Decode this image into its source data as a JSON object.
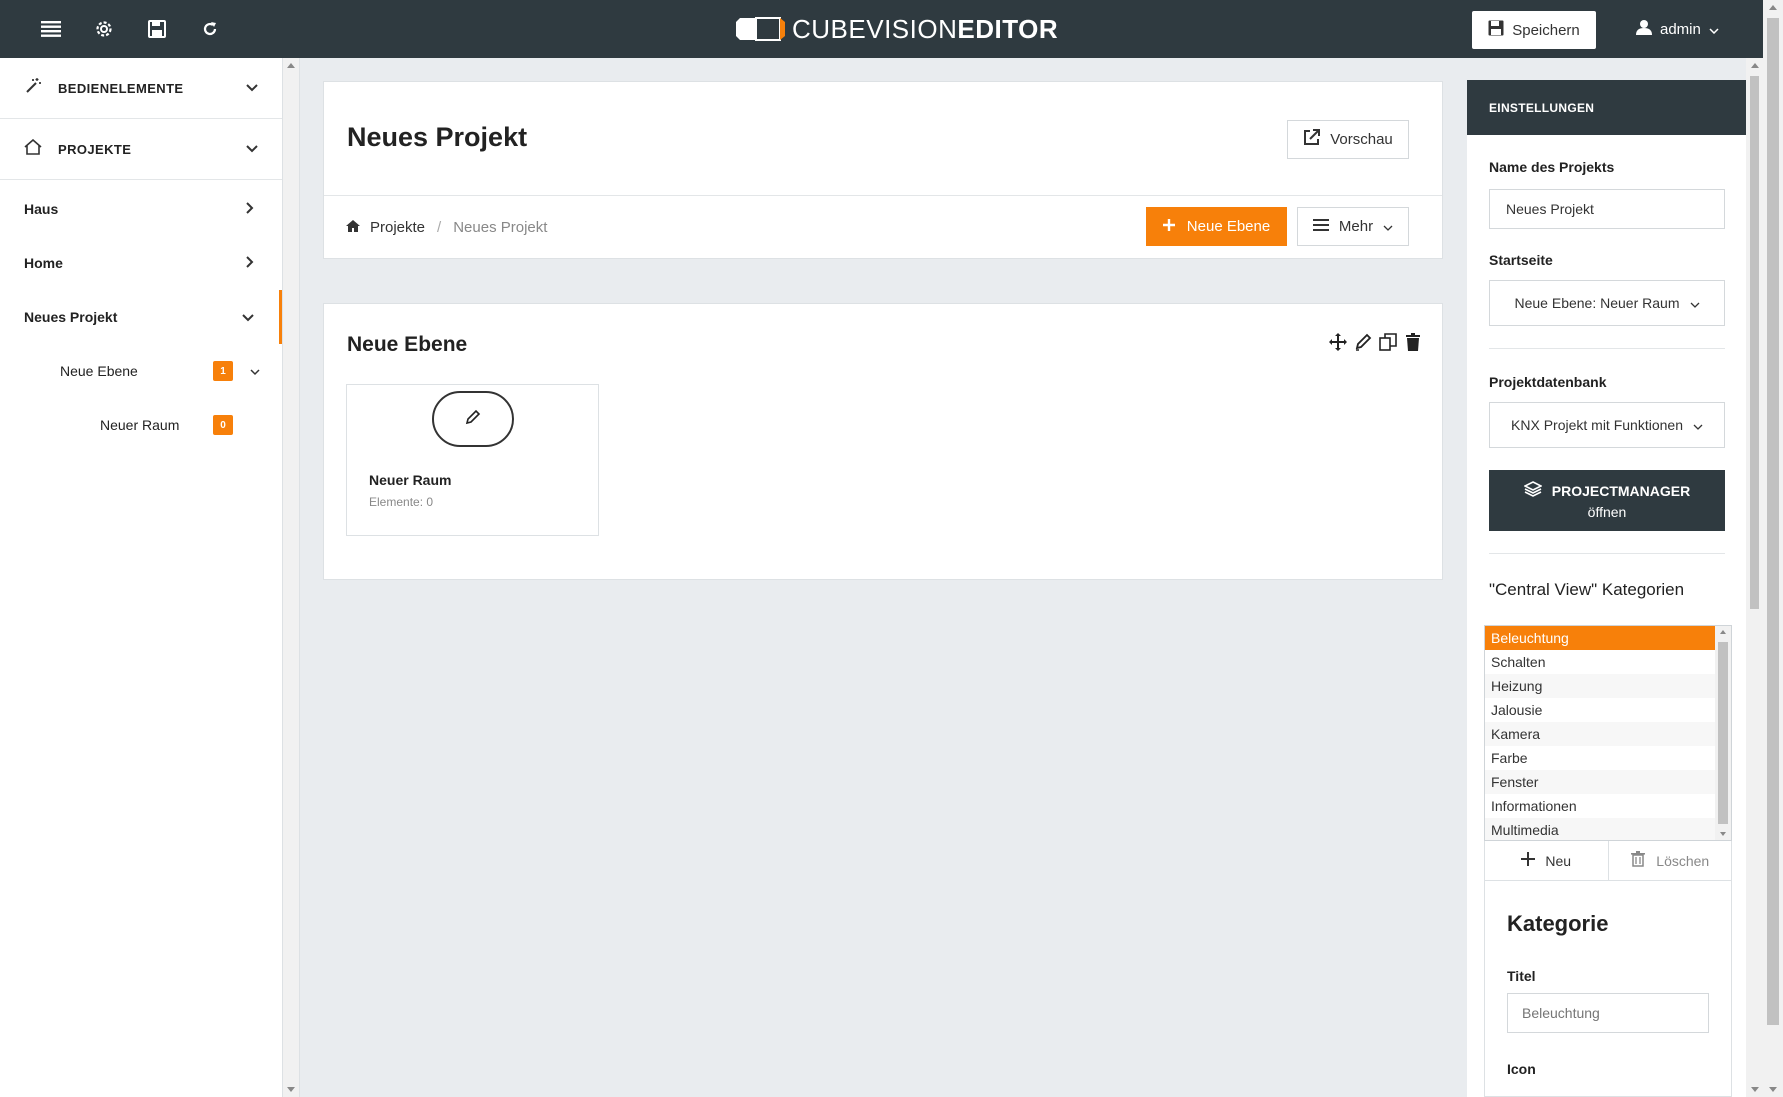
{
  "topbar": {
    "logo_part1": "CUBEVISION",
    "logo_part2": "EDITOR",
    "save_label": "Speichern",
    "user_label": "admin"
  },
  "sidebar": {
    "sections": [
      {
        "label": "BEDIENELEMENTE"
      },
      {
        "label": "PROJEKTE"
      }
    ],
    "items": [
      {
        "label": "Haus"
      },
      {
        "label": "Home"
      },
      {
        "label": "Neues Projekt"
      }
    ],
    "sub_level": {
      "label": "Neue Ebene",
      "badge": "1"
    },
    "sub_room": {
      "label": "Neuer Raum",
      "badge": "0"
    }
  },
  "header": {
    "title": "Neues Projekt",
    "preview_label": "Vorschau",
    "breadcrumb_root": "Projekte",
    "breadcrumb_sep": "/",
    "breadcrumb_current": "Neues Projekt",
    "new_level_label": "Neue Ebene",
    "more_label": "Mehr"
  },
  "level": {
    "title": "Neue Ebene",
    "room": {
      "name": "Neuer Raum",
      "elements": "Elemente: 0"
    }
  },
  "settings": {
    "header": "EINSTELLUNGEN",
    "project_name_label": "Name des Projekts",
    "project_name_value": "Neues Projekt",
    "start_label": "Startseite",
    "start_value": "Neue Ebene: Neuer Raum",
    "db_label": "Projektdatenbank",
    "db_value": "KNX Projekt mit Funktionen",
    "pm_button_bold": "PROJECTMANAGER",
    "pm_button_line2": "öffnen",
    "cv_title": "\"Central View\" Kategorien",
    "categories": [
      "Beleuchtung",
      "Schalten",
      "Heizung",
      "Jalousie",
      "Kamera",
      "Farbe",
      "Fenster",
      "Informationen",
      "Multimedia"
    ],
    "new_label": "Neu",
    "delete_label": "Löschen",
    "category_title": "Kategorie",
    "title_label": "Titel",
    "title_placeholder": "Beleuchtung",
    "icon_label": "Icon"
  },
  "colors": {
    "accent": "#f7800a",
    "dark": "#2f3a40"
  }
}
